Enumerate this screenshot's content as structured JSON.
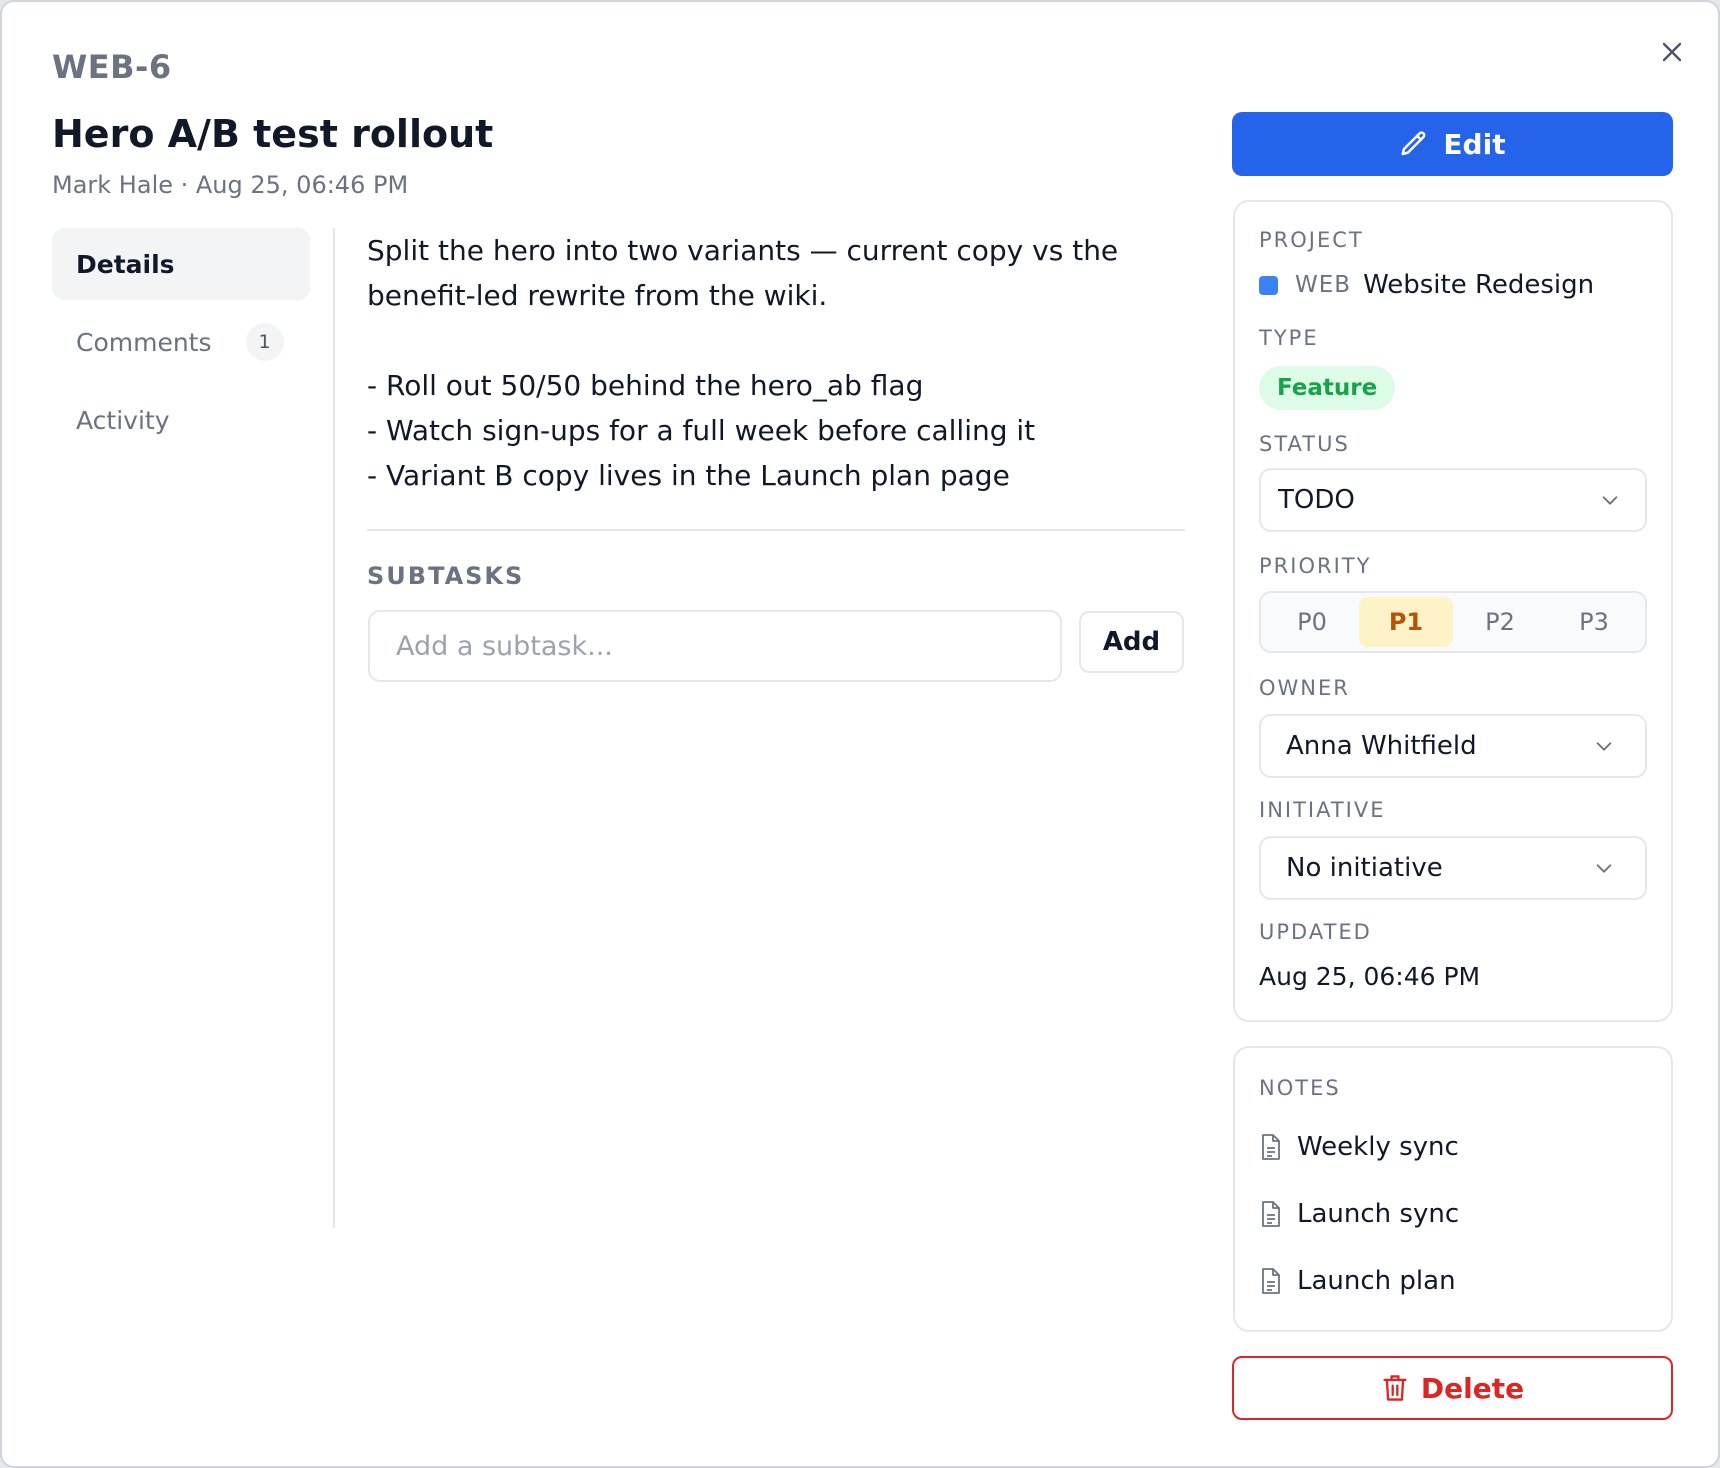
{
  "issue": {
    "id": "WEB-6",
    "title": "Hero A/B test rollout",
    "meta": "Mark Hale · Aug 25, 06:46 PM"
  },
  "nav": {
    "details": "Details",
    "comments": "Comments",
    "comments_count": "1",
    "activity": "Activity"
  },
  "description": {
    "line1": "Split the hero into two variants — current copy vs the",
    "line2": "benefit-led rewrite from the wiki.",
    "bullets": [
      "- Roll out 50/50 behind the hero_ab flag",
      "- Watch sign-ups for a full week before calling it",
      "- Variant B copy lives in the Launch plan page"
    ]
  },
  "subtasks": {
    "label": "SUBTASKS",
    "placeholder": "Add a subtask...",
    "add_label": "Add"
  },
  "actions": {
    "edit_label": "Edit",
    "delete_label": "Delete"
  },
  "properties": {
    "project_label": "PROJECT",
    "project_code": "WEB",
    "project_name": "Website Redesign",
    "project_color": "#3b82f6",
    "type_label": "TYPE",
    "type_value": "Feature",
    "status_label": "STATUS",
    "status_value": "TODO",
    "priority_label": "PRIORITY",
    "priority_options": [
      "P0",
      "P1",
      "P2",
      "P3"
    ],
    "priority_selected": "P1",
    "owner_label": "OWNER",
    "owner_value": "Anna Whitfield",
    "initiative_label": "INITIATIVE",
    "initiative_value": "No initiative",
    "updated_label": "UPDATED",
    "updated_value": "Aug 25, 06:46 PM"
  },
  "notes": {
    "label": "NOTES",
    "items": [
      "Weekly sync",
      "Launch sync",
      "Launch plan"
    ]
  },
  "colors": {
    "accent": "#2563eb",
    "danger": "#dc2626",
    "feature_bg": "#dcfce7",
    "feature_text": "#16a34a",
    "priority_active_bg": "#fef3c7",
    "priority_active_text": "#b45309"
  },
  "icons": {
    "close": "close-icon",
    "edit": "pencil-icon",
    "delete": "trash-icon",
    "note": "document-icon",
    "dropdown": "chevron-down-icon"
  }
}
